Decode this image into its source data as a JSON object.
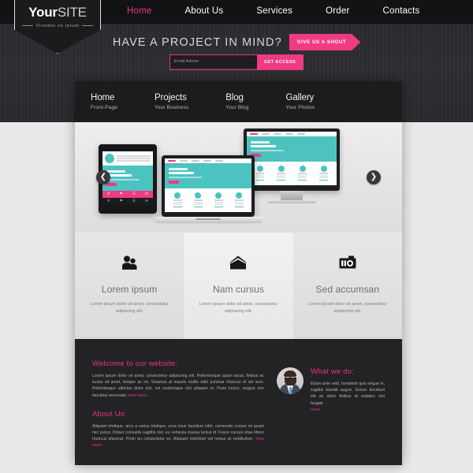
{
  "brand": {
    "accent": "#ee3b82",
    "dark": "#1c1b1e",
    "teal": "#4cc3c0",
    "logo_your": "Your",
    "logo_site": "SITE",
    "logo_tagline": "Vivamus eu ipsum"
  },
  "topnav": {
    "items": [
      {
        "label": "Home",
        "active": true
      },
      {
        "label": "About Us",
        "active": false
      },
      {
        "label": "Services",
        "active": false
      },
      {
        "label": "Order",
        "active": false
      },
      {
        "label": "Contacts",
        "active": false
      }
    ]
  },
  "hero": {
    "title": "HAVE A PROJECT IN MIND?",
    "cta_label": "GIVE US A SHOUT",
    "email_placeholder": "Email Adress",
    "email_value": "",
    "submit_label": "GET ACCESS"
  },
  "subnav": {
    "items": [
      {
        "title": "Home",
        "subtitle": "Front-Page"
      },
      {
        "title": "Projects",
        "subtitle": "Your Business"
      },
      {
        "title": "Blog",
        "subtitle": "Your Blog"
      },
      {
        "title": "Gallery",
        "subtitle": "Your Photos"
      }
    ]
  },
  "slider": {
    "prev_icon": "chevron-left-icon",
    "next_icon": "chevron-right-icon",
    "prev_glyph": "❮",
    "next_glyph": "❯",
    "mockup_heading_small": "Web Design",
    "mockup_heading_big": "Template"
  },
  "features": [
    {
      "icon": "users-icon",
      "title": "Lorem ipsum",
      "desc": "Lorem ipsum dolor sit amet, consectetur adipiscing elit."
    },
    {
      "icon": "envelope-icon",
      "title": "Nam cursus",
      "desc": "Lorem ipsum dolor sit amet, consectetur adipiscing elit."
    },
    {
      "icon": "camera-icon",
      "title": "Sed accumsan",
      "desc": "Lorem ipsum dolor sit amet, consectetur adipiscing elit."
    }
  ],
  "footer": {
    "welcome": {
      "heading": "Welcome to our website:",
      "body": "Lorem ipsum dolor sit amet, consectetur adipiscing elit. Pellentesque quam lacus, finibus ac luctus sit amet, tempor ac mi. Vivamus at mauris mollis odio pulvinar rhoncus et vel sem. Pellentesque ultricies dolor nisl, vel scelerisque nisl aliquam ut. Proin luctus, magna non faucibus venenatis ",
      "more": "View more..."
    },
    "about": {
      "heading": "About Us:",
      "body": "Aliquam tristique, arcu a varius tristique, urna risus faucibus nibh, commodo cursus mi quam nec purus. Donec convallis sagittis nisl, eu vehicula massa luctus id. Fusce cursus vitae libero rhoncus placerat. Proin eu consectetur ex. Aliquam interdum vel neque at vestibulum. ",
      "more": "View more..."
    },
    "whatwedo": {
      "heading": "What we do:",
      "body": "Etiam ante velit, hendrerit quis neque in, sagittis blandit augue. Donec tincidunt elit ac dolor finibus  id sodales nisl feugiat ",
      "more": "more...",
      "avatar_name": "avatar"
    }
  }
}
